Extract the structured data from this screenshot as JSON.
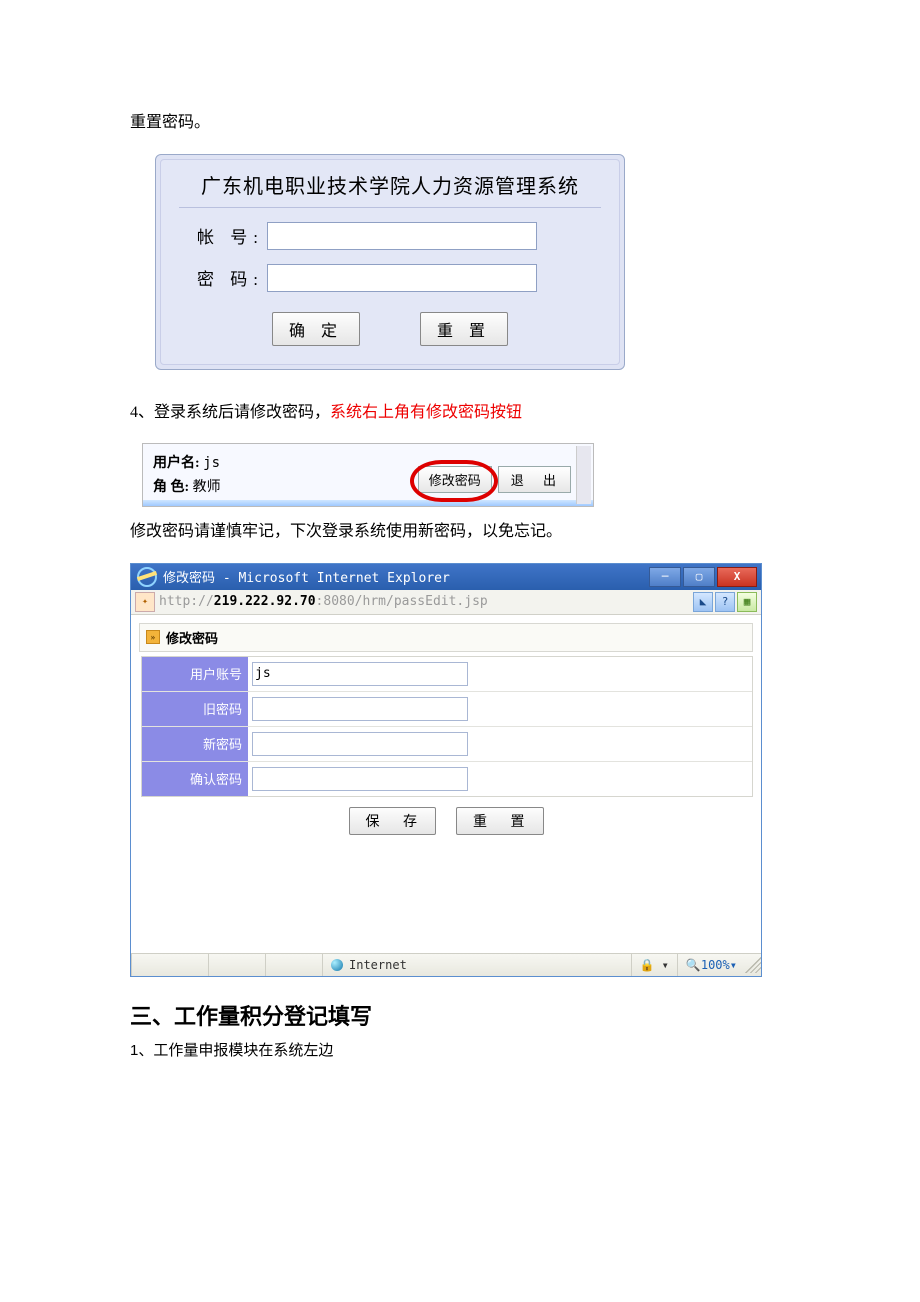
{
  "doc": {
    "p1": "重置密码。",
    "p2_a": "4、登录系统后请修改密码，",
    "p2_b": "系统右上角有修改密码按钮",
    "p3": "修改密码请谨慎牢记，下次登录系统使用新密码，以免忘记。",
    "h2": "三、工作量积分登记填写",
    "p4": "1、工作量申报模块在系统左边"
  },
  "login": {
    "title": "广东机电职业技术学院人力资源管理系统",
    "account_label": "帐 号:",
    "password_label": "密 码:",
    "ok": "确 定",
    "reset": "重 置"
  },
  "header_bar": {
    "user_label": "用户名:",
    "user_value": "js",
    "role_label": "角  色:",
    "role_value": "教师",
    "change_pw": "修改密码",
    "exit": "退  出"
  },
  "ie": {
    "title": "修改密码 - Microsoft Internet Explorer",
    "url_pre": "http://",
    "url_bold": "219.222.92.70",
    "url_post": ":8080/hrm/passEdit.jsp",
    "panel_title": "修改密码",
    "fields": {
      "account_label": "用户账号",
      "account_value": "js",
      "old_label": "旧密码",
      "new_label": "新密码",
      "confirm_label": "确认密码"
    },
    "save": "保  存",
    "reset": "重  置",
    "status_zone": "Internet",
    "zoom": "100%"
  }
}
